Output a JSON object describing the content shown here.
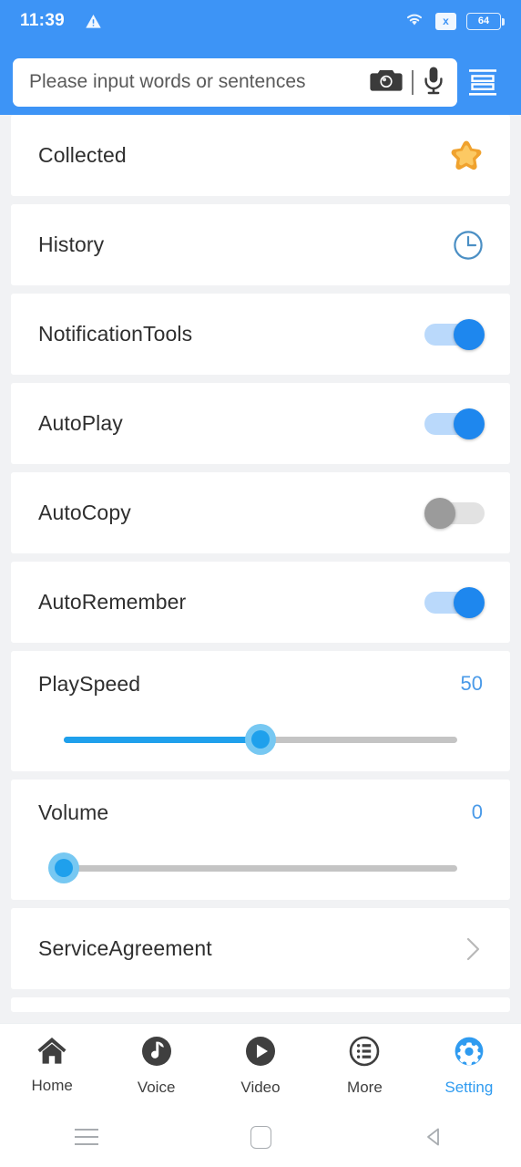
{
  "statusbar": {
    "time": "11:39",
    "warning_icon": "warning-triangle-icon",
    "wifi_icon": "wifi-icon",
    "nosim_label": "x",
    "battery_level": "64"
  },
  "search": {
    "placeholder": "Please input words or sentences",
    "value": "",
    "camera_icon": "camera-icon",
    "mic_icon": "microphone-icon",
    "menu_icon": "list-menu-icon"
  },
  "settings": {
    "items": [
      {
        "label": "Collected",
        "type": "icon",
        "icon": "star-icon"
      },
      {
        "label": "History",
        "type": "icon",
        "icon": "clock-icon"
      },
      {
        "label": "NotificationTools",
        "type": "toggle",
        "state": "on"
      },
      {
        "label": "AutoPlay",
        "type": "toggle",
        "state": "on"
      },
      {
        "label": "AutoCopy",
        "type": "toggle",
        "state": "off"
      },
      {
        "label": "AutoRemember",
        "type": "toggle",
        "state": "on"
      },
      {
        "label": "PlaySpeed",
        "type": "slider",
        "value": "50",
        "percent": 50
      },
      {
        "label": "Volume",
        "type": "slider",
        "value": "0",
        "percent": 0
      },
      {
        "label": "ServiceAgreement",
        "type": "link",
        "icon": "chevron-right-icon"
      }
    ]
  },
  "bottom_nav": {
    "items": [
      {
        "label": "Home",
        "icon": "home-icon",
        "active": false
      },
      {
        "label": "Voice",
        "icon": "music-note-icon",
        "active": false
      },
      {
        "label": "Video",
        "icon": "play-icon",
        "active": false
      },
      {
        "label": "More",
        "icon": "grid-list-icon",
        "active": false
      },
      {
        "label": "Setting",
        "icon": "gear-icon",
        "active": true
      }
    ]
  },
  "system_nav": {
    "recents_icon": "recents-icon",
    "home_icon": "home-square-icon",
    "back_icon": "back-triangle-icon"
  },
  "colors": {
    "header_blue": "#3d94f6",
    "accent_blue": "#1fa0ec",
    "toggle_on": "#1e87ee",
    "toggle_off": "#9b9b9b",
    "star_gold": "#f5a623",
    "page_bg": "#f1f2f4"
  }
}
